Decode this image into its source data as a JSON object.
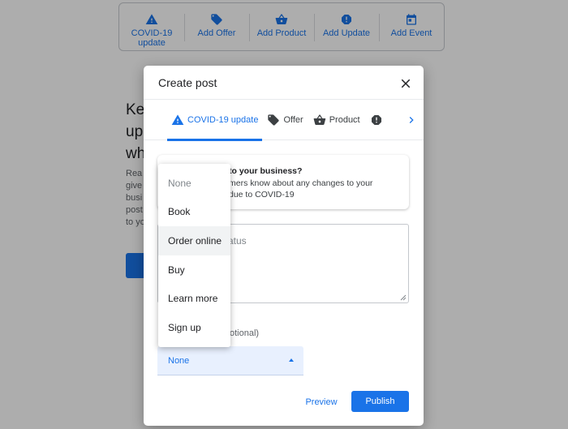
{
  "toolbar": {
    "items": [
      {
        "label": "COVID-19\nupdate",
        "icon": "warning-icon"
      },
      {
        "label": "Add Offer",
        "icon": "tag-icon"
      },
      {
        "label": "Add Product",
        "icon": "basket-icon"
      },
      {
        "label": "Add Update",
        "icon": "alert-icon"
      },
      {
        "label": "Add Event",
        "icon": "calendar-icon"
      }
    ]
  },
  "modal": {
    "title": "Create post",
    "tabs": [
      {
        "label": "COVID-19 update",
        "icon": "warning-icon",
        "active": true
      },
      {
        "label": "Offer",
        "icon": "tag-icon"
      },
      {
        "label": "Product",
        "icon": "basket-icon"
      },
      {
        "label": "",
        "icon": "alert-icon"
      }
    ],
    "info_card": {
      "title": "to your business?",
      "line1": "mers know about any changes to your",
      "line2": "due to COVID-19"
    },
    "textarea_placeholder": "atus",
    "button_label": "otional)",
    "select_value": "None",
    "preview_label": "Preview",
    "publish_label": "Publish"
  },
  "dropdown": {
    "options": [
      "None",
      "Book",
      "Order online",
      "Buy",
      "Learn more",
      "Sign up"
    ],
    "hovered": "Order online"
  },
  "colors": {
    "accent": "#1a73e8",
    "overlay": "rgba(0,0,0,0.32)"
  }
}
